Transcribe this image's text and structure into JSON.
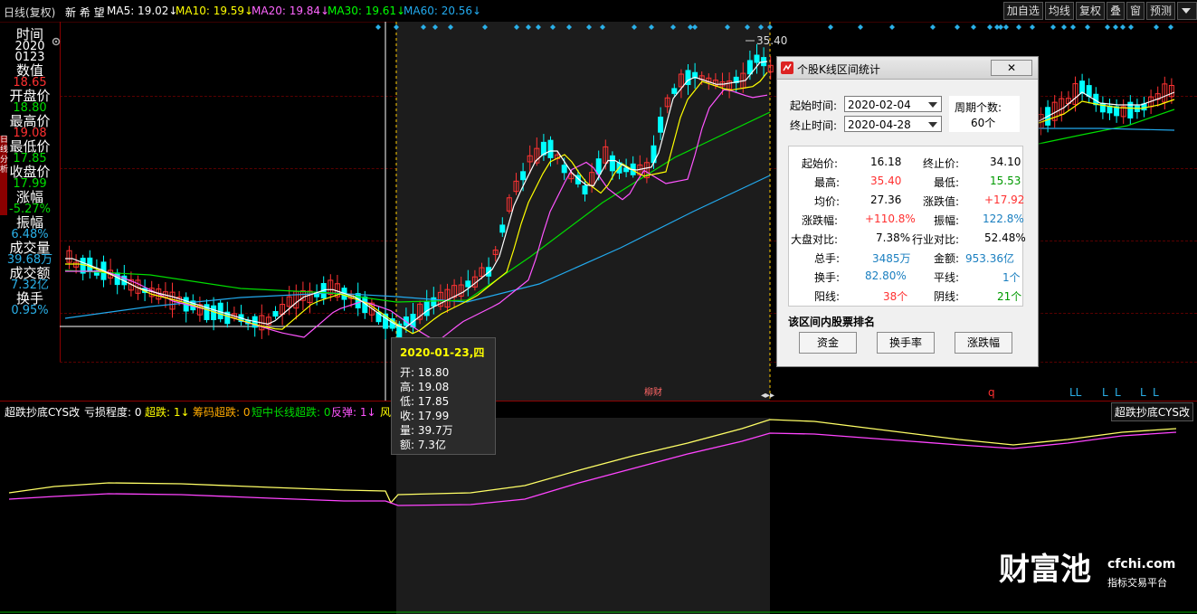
{
  "header": {
    "period": "日线(复权)",
    "stock_name": "新 希 望",
    "ma5": "MA5: 19.02↓",
    "ma10": "MA10: 19.59↓",
    "ma20": "MA20: 19.84↓",
    "ma30": "MA30: 19.61↓",
    "ma60": "MA60: 20.56↓",
    "buttons": [
      "加自选",
      "均线",
      "复权",
      "叠",
      "窗",
      "预测"
    ],
    "expand_icon": "arrow-down-icon"
  },
  "left_panel": {
    "time_label": "时间",
    "time_year": "2020",
    "time_md": "0123",
    "value_label": "数值",
    "value": "18.65",
    "open_label": "开盘价",
    "open": "18.80",
    "high_label": "最高价",
    "high": "19.08",
    "low_label": "最低价",
    "low": "17.85",
    "close_label": "收盘价",
    "close": "17.99",
    "change_label": "涨幅",
    "change": "-5.27%",
    "amplitude_label": "振幅",
    "amplitude": "6.48%",
    "volume_label": "成交量",
    "volume": "39.68万",
    "turnover_label": "成交额",
    "turnover": "7.32亿",
    "exchange_label": "换手",
    "exchange": "0.95%"
  },
  "chart": {
    "peak_label": "35.40",
    "marker_label": "柳财",
    "marker_q": "q",
    "marker_l": [
      "LL",
      "L",
      "L",
      "L",
      "L"
    ],
    "colors": {
      "up": "#ff3333",
      "down": "#00ffff",
      "ma5": "#ffffff",
      "ma10": "#ffff00",
      "ma20": "#ff66ff",
      "ma30": "#00ff00",
      "ma60": "#22aaee"
    }
  },
  "tooltip": {
    "date": "2020-01-23,四",
    "open": "开: 18.80",
    "high": "高: 19.08",
    "low": "低: 17.85",
    "close": "收: 17.99",
    "volume": "量: 39.7万",
    "amount": "额: 7.3亿"
  },
  "dialog": {
    "title": "个股K线区间统计",
    "close_label": "✕",
    "start_label": "起始时间:",
    "start_value": "2020-02-04",
    "end_label": "终止时间:",
    "end_value": "2020-04-28",
    "period_label": "周期个数:",
    "period_value": "60个",
    "stats": {
      "start_price_label": "起始价:",
      "start_price": "16.18",
      "end_price_label": "终止价:",
      "end_price": "34.10",
      "high_label": "最高:",
      "high": "35.40",
      "low_label": "最低:",
      "low": "15.53",
      "avg_label": "均价:",
      "avg": "27.36",
      "change_val_label": "涨跌值:",
      "change_val": "+17.92",
      "change_pct_label": "涨跌幅:",
      "change_pct": "+110.8%",
      "amp_label": "振幅:",
      "amp": "122.8%",
      "market_label": "大盘对比:",
      "market": "7.38%",
      "industry_label": "行业对比:",
      "industry": "52.48%",
      "hands_label": "总手:",
      "hands": "3485万",
      "amount_label": "金额:",
      "amount": "953.36亿",
      "turnover_label": "换手:",
      "turnover": "82.80%",
      "flat_label": "平线:",
      "flat": "1个",
      "yang_label": "阳线:",
      "yang": "38个",
      "yin_label": "阴线:",
      "yin": "21个"
    },
    "rank_label": "该区间内股票排名",
    "rank_buttons": [
      "资金",
      "换手率",
      "涨跌幅"
    ]
  },
  "indicator": {
    "name": "超跌抄底CYS改",
    "loss": "亏损程度: 0",
    "oversold": "超跌: 1↓",
    "chip": "筹码超跌: 0",
    "midlong": "短中长线超跌: 0",
    "rebound": "反弹: 1↓",
    "risk": "风",
    "right_label": "超跌抄底CYS改"
  },
  "watermark": {
    "brand": "财富池",
    "domain": "cfchi.com",
    "tagline": "指标交易平台"
  }
}
